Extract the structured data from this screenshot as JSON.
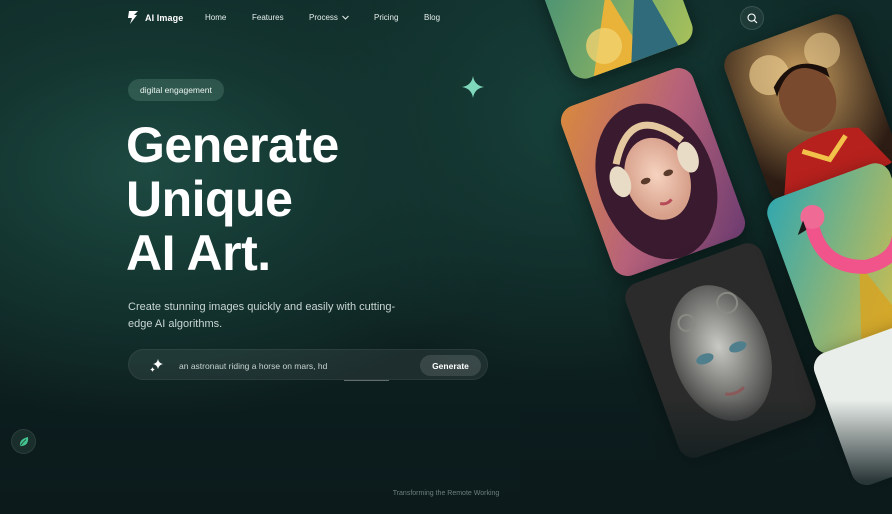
{
  "nav": {
    "logo_text": "AI Image",
    "logo_icon": "lightning-bolt-icon",
    "links": {
      "home": "Home",
      "features": "Features",
      "process": "Process",
      "pricing": "Pricing",
      "blog": "Blog"
    },
    "search_icon": "search-icon"
  },
  "hero": {
    "badge": "digital engagement",
    "headline_line1": "Generate",
    "headline_line2": "Unique",
    "headline_line3": "AI Art.",
    "subtitle": "Create stunning images quickly and easily with cutting-edge AI algorithms.",
    "prompt": {
      "placeholder": "an astronaut riding a horse on mars, hd",
      "button": "Generate",
      "icon": "sparkles-icon"
    }
  },
  "footer": {
    "text": "Transforming the Remote Working"
  },
  "colors": {
    "background": "#0d2120",
    "accent": "#5fd3a8",
    "badge_bg": "#2f4f45"
  }
}
